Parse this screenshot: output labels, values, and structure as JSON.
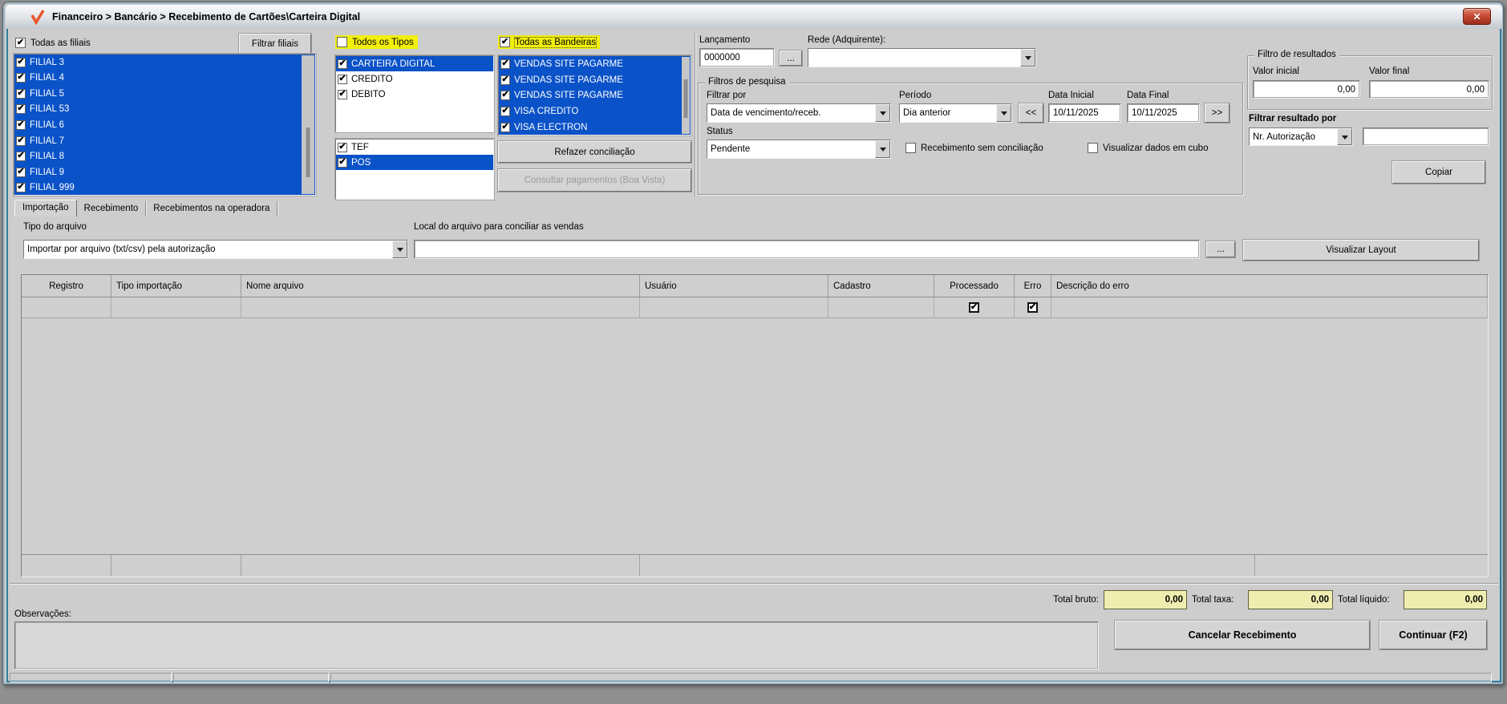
{
  "window": {
    "title": "Financeiro > Bancário > Recebimento de Cartões\\Carteira Digital",
    "close_glyph": "✕"
  },
  "icons": {
    "app": "orange-check-mark",
    "dropdown": "down-triangle",
    "checkbox_check": "✔"
  },
  "colors": {
    "selection_blue": "#0a52c8",
    "highlight_yellow": "#f2ef0a",
    "totals_yellow": "#efedb0",
    "close_red": "#9c2d1d"
  },
  "filiais": {
    "all_label": "Todas as filiais",
    "filter_button": "Filtrar filiais",
    "items": [
      {
        "label": "FILIAL 3",
        "checked": true,
        "selected": true
      },
      {
        "label": "FILIAL 4",
        "checked": true,
        "selected": true
      },
      {
        "label": "FILIAL 5",
        "checked": true,
        "selected": true
      },
      {
        "label": "FILIAL 53",
        "checked": true,
        "selected": true
      },
      {
        "label": "FILIAL 6",
        "checked": true,
        "selected": true
      },
      {
        "label": "FILIAL 7",
        "checked": true,
        "selected": true
      },
      {
        "label": "FILIAL 8",
        "checked": true,
        "selected": true
      },
      {
        "label": "FILIAL 9",
        "checked": true,
        "selected": true
      },
      {
        "label": "FILIAL 999",
        "checked": true,
        "selected": true
      }
    ]
  },
  "tipos": {
    "all_label": "Todos os Tipos",
    "items": [
      {
        "label": "CARTEIRA DIGITAL",
        "checked": true,
        "selected": true
      },
      {
        "label": "CREDITO",
        "checked": true,
        "selected": false
      },
      {
        "label": "DEBITO",
        "checked": true,
        "selected": false
      }
    ],
    "modos": [
      {
        "label": "TEF",
        "checked": true,
        "selected": false
      },
      {
        "label": "POS",
        "checked": true,
        "selected": true
      }
    ]
  },
  "bandeiras": {
    "all_label": "Todas as Bandeiras",
    "items": [
      {
        "label": "VENDAS SITE PAGARME",
        "checked": true,
        "selected": true
      },
      {
        "label": "VENDAS SITE PAGARME",
        "checked": true,
        "selected": true
      },
      {
        "label": "VENDAS SITE PAGARME",
        "checked": true,
        "selected": true
      },
      {
        "label": "VISA CREDITO",
        "checked": true,
        "selected": true
      },
      {
        "label": "VISA ELECTRON",
        "checked": true,
        "selected": true
      }
    ],
    "refazer_button": "Refazer conciliação",
    "consultar_button": "Consultar pagamentos (Boa Vista)"
  },
  "lancamento": {
    "label": "Lançamento",
    "value": "0000000",
    "browse": "...",
    "rede_label": "Rede (Adquirente):"
  },
  "filtros": {
    "title": "Filtros de pesquisa",
    "filtrar_por_label": "Filtrar por",
    "filtrar_por_value": "Data de vencimento/receb.",
    "periodo_label": "Período",
    "periodo_value": "Dia anterior",
    "prev": "<<",
    "next": ">>",
    "data_inicial_label": "Data Inicial",
    "data_inicial": "10/11/2025",
    "data_final_label": "Data Final",
    "data_final": "10/11/2025",
    "status_label": "Status",
    "status_value": "Pendente",
    "cb_sem_conciliacao": "Recebimento sem conciliação",
    "cb_cubo": "Visualizar dados em cubo"
  },
  "resultados": {
    "title": "Filtro de resultados",
    "valor_inicial_label": "Valor inicial",
    "valor_inicial": "0,00",
    "valor_final_label": "Valor final",
    "valor_final": "0,00",
    "filtrar_label": "Filtrar resultado por",
    "filtrar_value": "Nr. Autorização",
    "copiar_button": "Copiar"
  },
  "tabs": {
    "importacao": "Importação",
    "recebimento": "Recebimento",
    "operadora": "Recebimentos na operadora"
  },
  "arquivo": {
    "tipo_label": "Tipo do arquivo",
    "tipo_value": "Importar por arquivo (txt/csv) pela autorização",
    "local_label": "Local do arquivo para conciliar as vendas",
    "browse": "...",
    "layout_button": "Visualizar Layout"
  },
  "table": {
    "headers": [
      "Registro",
      "Tipo importação",
      "Nome arquivo",
      "Usuário",
      "Cadastro",
      "Processado",
      "Erro",
      "Descrição do erro"
    ]
  },
  "totais": {
    "bruto_label": "Total bruto:",
    "bruto": "0,00",
    "taxa_label": "Total taxa:",
    "taxa": "0,00",
    "liquido_label": "Total líquido:",
    "liquido": "0,00"
  },
  "rodape": {
    "observacoes_label": "Observações:",
    "cancelar_button": "Cancelar Recebimento",
    "continuar_button": "Continuar (F2)"
  }
}
